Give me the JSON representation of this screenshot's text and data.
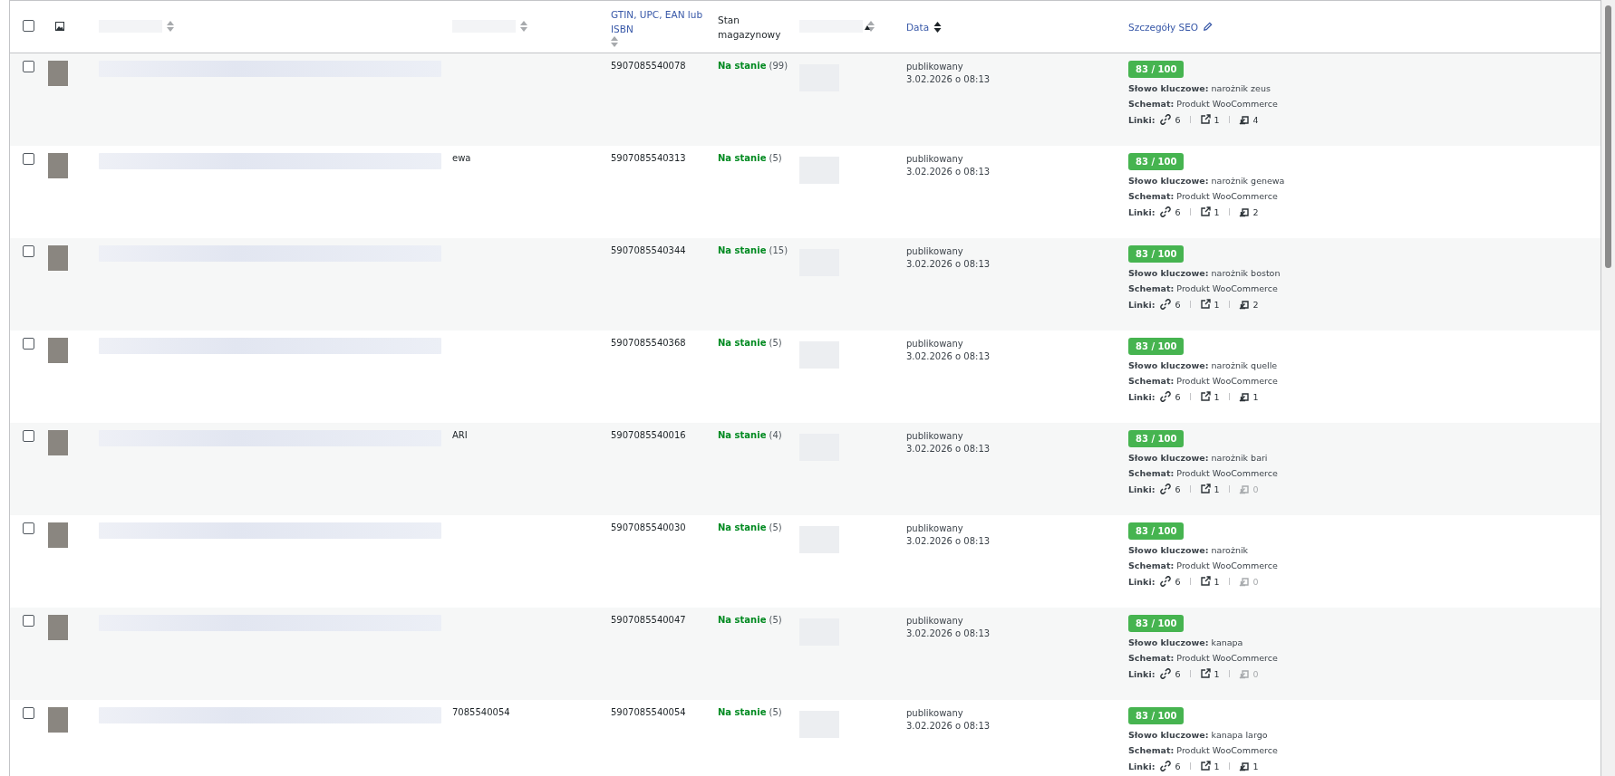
{
  "header": {
    "select_all": {
      "checked": false
    },
    "columns": [
      {
        "kind": "blurred",
        "sorted": false
      },
      {
        "kind": "blurred",
        "sorted": false
      },
      {
        "kind": "text",
        "label": "GTIN, UPC, EAN lub ISBN",
        "sorted": false
      },
      {
        "kind": "plain",
        "label": "Stan magazynowy"
      },
      {
        "kind": "blurred",
        "sorted": false
      },
      {
        "kind": "mark"
      },
      {
        "kind": "text",
        "label": "Data",
        "sorted": true
      },
      {
        "kind": "edit",
        "label": "Szczegóły SEO"
      }
    ]
  },
  "rows": [
    {
      "checked": false,
      "sku": "",
      "gtin": "5907085540078",
      "stock": "Na stanie",
      "stock_count": "(99)",
      "status": "publikowany",
      "date": "3.02.2026 o 08:13",
      "score": "83 / 100",
      "keyword": "**Słowo kluczowe:** narożnik zeus",
      "schema": "**Schemat:** Produkt WooCommerce",
      "links_label": "Linki:",
      "links": [
        {
          "kind": "chain",
          "count": "6",
          "muted": false
        },
        {
          "kind": "external",
          "count": "1",
          "muted": false
        },
        {
          "kind": "internal",
          "count": "4",
          "muted": false
        }
      ]
    },
    {
      "checked": false,
      "sku": "ewa",
      "gtin": "5907085540313",
      "stock": "Na stanie",
      "stock_count": "(5)",
      "status": "publikowany",
      "date": "3.02.2026 o 08:13",
      "score": "83 / 100",
      "keyword": "**Słowo kluczowe:** narożnik genewa",
      "schema": "**Schemat:** Produkt WooCommerce",
      "links_label": "Linki:",
      "links": [
        {
          "kind": "chain",
          "count": "6",
          "muted": false
        },
        {
          "kind": "external",
          "count": "1",
          "muted": false
        },
        {
          "kind": "internal",
          "count": "2",
          "muted": false
        }
      ]
    },
    {
      "checked": false,
      "sku": "",
      "gtin": "5907085540344",
      "stock": "Na stanie",
      "stock_count": "(15)",
      "status": "publikowany",
      "date": "3.02.2026 o 08:13",
      "score": "83 / 100",
      "keyword": "**Słowo kluczowe:** narożnik boston",
      "schema": "**Schemat:** Produkt WooCommerce",
      "links_label": "Linki:",
      "links": [
        {
          "kind": "chain",
          "count": "6",
          "muted": false
        },
        {
          "kind": "external",
          "count": "1",
          "muted": false
        },
        {
          "kind": "internal",
          "count": "2",
          "muted": false
        }
      ]
    },
    {
      "checked": false,
      "sku": "",
      "gtin": "5907085540368",
      "stock": "Na stanie",
      "stock_count": "(5)",
      "status": "publikowany",
      "date": "3.02.2026 o 08:13",
      "score": "83 / 100",
      "keyword": "**Słowo kluczowe:** narożnik quelle",
      "schema": "**Schemat:** Produkt WooCommerce",
      "links_label": "Linki:",
      "links": [
        {
          "kind": "chain",
          "count": "6",
          "muted": false
        },
        {
          "kind": "external",
          "count": "1",
          "muted": false
        },
        {
          "kind": "internal",
          "count": "1",
          "muted": false
        }
      ]
    },
    {
      "checked": false,
      "sku": "ARI",
      "gtin": "5907085540016",
      "stock": "Na stanie",
      "stock_count": "(4)",
      "status": "publikowany",
      "date": "3.02.2026 o 08:13",
      "score": "83 / 100",
      "keyword": "**Słowo kluczowe:** narożnik bari",
      "schema": "**Schemat:** Produkt WooCommerce",
      "links_label": "Linki:",
      "links": [
        {
          "kind": "chain",
          "count": "6",
          "muted": false
        },
        {
          "kind": "external",
          "count": "1",
          "muted": false
        },
        {
          "kind": "internal",
          "count": "0",
          "muted": true
        }
      ]
    },
    {
      "checked": false,
      "sku": "",
      "gtin": "5907085540030",
      "stock": "Na stanie",
      "stock_count": "(5)",
      "status": "publikowany",
      "date": "3.02.2026 o 08:13",
      "score": "83 / 100",
      "keyword": "**Słowo kluczowe:** narożnik",
      "schema": "**Schemat:** Produkt WooCommerce",
      "links_label": "Linki:",
      "links": [
        {
          "kind": "chain",
          "count": "6",
          "muted": false
        },
        {
          "kind": "external",
          "count": "1",
          "muted": false
        },
        {
          "kind": "internal",
          "count": "0",
          "muted": true
        }
      ]
    },
    {
      "checked": false,
      "sku": "",
      "gtin": "5907085540047",
      "stock": "Na stanie",
      "stock_count": "(5)",
      "status": "publikowany",
      "date": "3.02.2026 o 08:13",
      "score": "83 / 100",
      "keyword": "**Słowo kluczowe:** kanapa",
      "schema": "**Schemat:** Produkt WooCommerce",
      "links_label": "Linki:",
      "links": [
        {
          "kind": "chain",
          "count": "6",
          "muted": false
        },
        {
          "kind": "external",
          "count": "1",
          "muted": false
        },
        {
          "kind": "internal",
          "count": "0",
          "muted": true
        }
      ]
    },
    {
      "checked": false,
      "sku": "7085540054",
      "gtin": "5907085540054",
      "stock": "Na stanie",
      "stock_count": "(5)",
      "status": "publikowany",
      "date": "3.02.2026 o 08:13",
      "score": "83 / 100",
      "keyword": "**Słowo kluczowe:** kanapa largo",
      "schema": "**Schemat:** Produkt WooCommerce",
      "links_label": "Linki:",
      "links": [
        {
          "kind": "chain",
          "count": "6",
          "muted": false
        },
        {
          "kind": "external",
          "count": "1",
          "muted": false
        },
        {
          "kind": "internal",
          "count": "1",
          "muted": false
        }
      ]
    }
  ]
}
